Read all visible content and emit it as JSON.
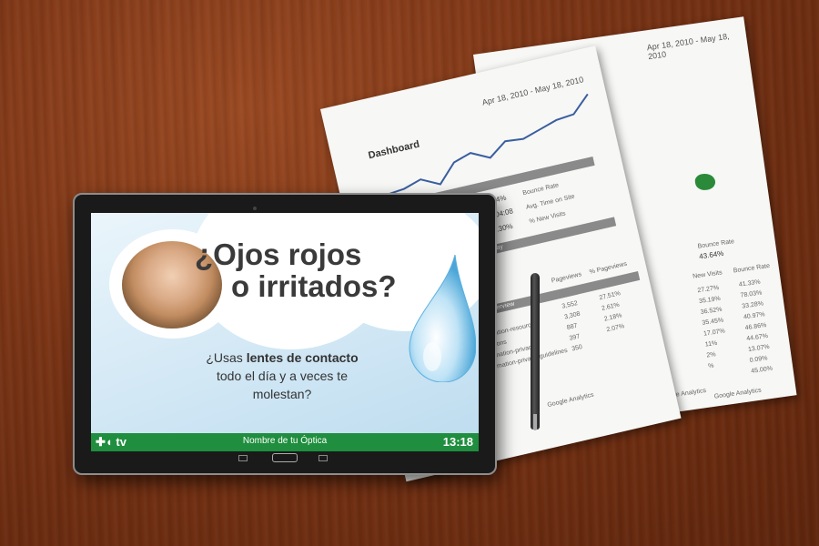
{
  "tablet_screen": {
    "headline_line1": "¿Ojos rojos",
    "headline_line2": "o irritados?",
    "question_part1": "¿Usas ",
    "question_bold": "lentes de contacto",
    "question_line2": "todo el día y a veces te",
    "question_line3": "molestan?",
    "footer": {
      "logo": "tv",
      "shop_name": "Nombre de tu Óptica",
      "time": "13:18"
    }
  },
  "paper_front": {
    "date_range": "Apr 18, 2010 - May 18, 2010",
    "title": "Dashboard",
    "bounce_rate": "43.64%",
    "bounce_label": "Bounce Rate",
    "time_on_site": "00:04:08",
    "time_label": "Avg. Time on Site",
    "new_visits": "28.30%",
    "new_visits_label": "% New Visits",
    "map_overlay": "Map Overlay",
    "content_overview": "Content Overview",
    "columns": [
      "Pageviews",
      "% Pageviews"
    ],
    "rows": [
      {
        "page": "/",
        "pageviews": "3,552",
        "pct": "27.51%"
      },
      {
        "page": "/information-resources",
        "pageviews": "3,308",
        "pct": "2.61%"
      },
      {
        "page": "/directions",
        "pageviews": "887",
        "pct": "2.18%"
      },
      {
        "page": "/information-privacy",
        "pageviews": "397",
        "pct": "2.07%"
      },
      {
        "page": "/information-privacy-guidelines",
        "pageviews": "350",
        "pct": ""
      }
    ],
    "footer": "Google Analytics"
  },
  "paper_back": {
    "date_range": "Apr 18, 2010 - May 18, 2010",
    "bounce_label": "Bounce Rate",
    "bounce_value": "43.64%",
    "col_headers": [
      "New Visits",
      "Bounce Rate"
    ],
    "rows": [
      [
        "27.27%",
        "41.33%"
      ],
      [
        "35.19%",
        "78.03%"
      ],
      [
        "36.52%",
        "33.28%"
      ],
      [
        "35.45%",
        "40.97%"
      ],
      [
        "17.07%",
        "46.86%"
      ],
      [
        "11%",
        "44.67%"
      ],
      [
        "2%",
        "13.07%"
      ],
      [
        "%",
        "0.09%"
      ],
      [
        "",
        "45.00%"
      ]
    ],
    "footer": "Google Analytics",
    "footer2": "Google Analytics"
  },
  "colors": {
    "footer_green": "#1f8e3e",
    "wood": "#7a3415"
  }
}
